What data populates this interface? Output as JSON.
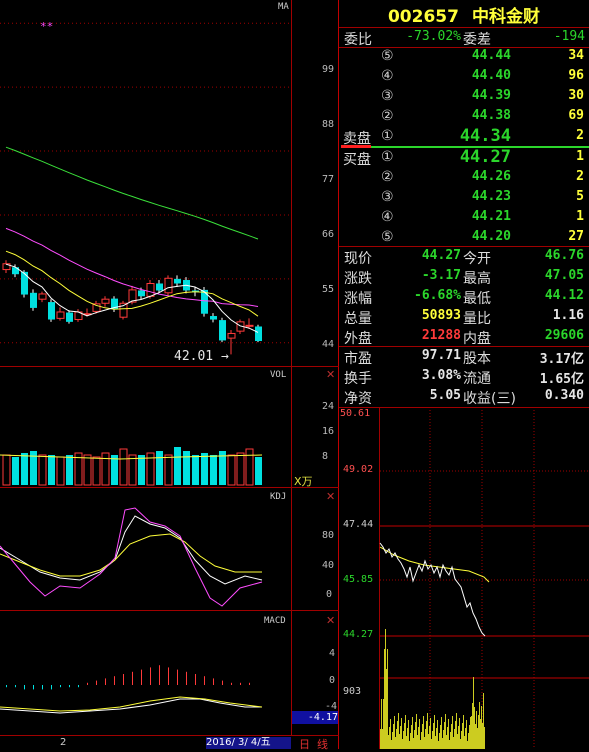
{
  "stock": {
    "code": "002657",
    "name": "中科金财"
  },
  "main_chart": {
    "indicator_label": "MA",
    "marker": "**",
    "y_ticks": [
      "99",
      "88",
      "77",
      "66",
      "55",
      "44"
    ],
    "low_annotation": "42.01 →"
  },
  "vol_panel": {
    "title": "VOL",
    "y_ticks": [
      "24",
      "16",
      "8"
    ],
    "unit": "X万"
  },
  "kdj_panel": {
    "title": "KDJ",
    "y_ticks": [
      "80",
      "40",
      "0"
    ]
  },
  "macd_panel": {
    "title": "MACD",
    "y_ticks": [
      "4",
      "0",
      "-4"
    ],
    "current": "-4.17"
  },
  "bottom": {
    "tick": "2",
    "date": "2016/ 3/ 4/五",
    "tab1": "日",
    "tab2": "线"
  },
  "orderbook": {
    "weibi_label": "委比",
    "weibi": "-73.02%",
    "weicha_label": "委差",
    "weicha": "-194",
    "sell_label": "卖盘",
    "buy_label": "买盘",
    "sells": [
      {
        "lvl": "⑤",
        "price": "44.44",
        "vol": "34"
      },
      {
        "lvl": "④",
        "price": "44.40",
        "vol": "96"
      },
      {
        "lvl": "③",
        "price": "44.39",
        "vol": "30"
      },
      {
        "lvl": "②",
        "price": "44.38",
        "vol": "69"
      },
      {
        "lvl": "①",
        "price": "44.34",
        "vol": "2"
      }
    ],
    "buys": [
      {
        "lvl": "①",
        "price": "44.27",
        "vol": "1"
      },
      {
        "lvl": "②",
        "price": "44.26",
        "vol": "2"
      },
      {
        "lvl": "③",
        "price": "44.23",
        "vol": "5"
      },
      {
        "lvl": "④",
        "price": "44.21",
        "vol": "1"
      },
      {
        "lvl": "⑤",
        "price": "44.20",
        "vol": "27"
      }
    ]
  },
  "quote": [
    {
      "l1": "现价",
      "v1": "44.27",
      "c1": "green",
      "l2": "今开",
      "v2": "46.76",
      "c2": "green"
    },
    {
      "l1": "涨跌",
      "v1": "-3.17",
      "c1": "green",
      "l2": "最高",
      "v2": "47.05",
      "c2": "green"
    },
    {
      "l1": "涨幅",
      "v1": "-6.68%",
      "c1": "green",
      "l2": "最低",
      "v2": "44.12",
      "c2": "green"
    },
    {
      "l1": "总量",
      "v1": "50893",
      "c1": "yellow",
      "l2": "量比",
      "v2": "1.16",
      "c2": "white"
    },
    {
      "l1": "外盘",
      "v1": "21288",
      "c1": "red",
      "l2": "内盘",
      "v2": "29606",
      "c2": "green"
    },
    {
      "l1": "市盈",
      "v1": "97.71",
      "c1": "white",
      "l2": "股本",
      "v2": "3.17亿",
      "c2": "white"
    },
    {
      "l1": "换手",
      "v1": "3.08%",
      "c1": "white",
      "l2": "流通",
      "v2": "1.65亿",
      "c2": "white"
    },
    {
      "l1": "净资",
      "v1": "5.05",
      "c1": "white",
      "l2": "收益(三)",
      "v2": "0.340",
      "c2": "white"
    }
  ],
  "intraday": {
    "price_ticks": [
      "50.61",
      "49.02",
      "47.44",
      "45.85",
      "44.27"
    ],
    "vol_tick": "903"
  },
  "colors": {
    "up": "#ff3a3a",
    "down": "#00e0e0",
    "grid": "#a00000",
    "ma5": "#ffffff",
    "ma10": "#ffff3a",
    "ma20": "#ff4dff",
    "ma60": "#3ae03a"
  },
  "chart_data": {
    "type": "candlestick",
    "ylim": [
      40,
      103
    ],
    "candles": [
      {
        "o": 56.6,
        "c": 57.6,
        "h": 58.2,
        "l": 56.0
      },
      {
        "o": 57.0,
        "c": 55.8,
        "h": 57.5,
        "l": 55.3
      },
      {
        "o": 56.2,
        "c": 52.3,
        "h": 56.5,
        "l": 51.8
      },
      {
        "o": 52.6,
        "c": 50.0,
        "h": 53.2,
        "l": 49.5
      },
      {
        "o": 51.5,
        "c": 52.4,
        "h": 52.8,
        "l": 51.0
      },
      {
        "o": 51.0,
        "c": 48.0,
        "h": 51.5,
        "l": 47.6
      },
      {
        "o": 48.2,
        "c": 49.3,
        "h": 50.1,
        "l": 47.8
      },
      {
        "o": 49.2,
        "c": 47.6,
        "h": 49.6,
        "l": 47.3
      },
      {
        "o": 48.0,
        "c": 49.3,
        "h": 49.8,
        "l": 47.6
      },
      {
        "o": 49.0,
        "c": 49.0,
        "h": 49.9,
        "l": 48.5
      },
      {
        "o": 49.4,
        "c": 50.7,
        "h": 51.2,
        "l": 49.0
      },
      {
        "o": 50.8,
        "c": 51.5,
        "h": 52.0,
        "l": 50.2
      },
      {
        "o": 51.6,
        "c": 49.8,
        "h": 52.0,
        "l": 49.3
      },
      {
        "o": 48.4,
        "c": 50.8,
        "h": 51.2,
        "l": 48.0
      },
      {
        "o": 51.0,
        "c": 53.1,
        "h": 53.8,
        "l": 50.6
      },
      {
        "o": 53.0,
        "c": 52.0,
        "h": 53.5,
        "l": 51.5
      },
      {
        "o": 52.0,
        "c": 54.2,
        "h": 54.8,
        "l": 51.6
      },
      {
        "o": 54.2,
        "c": 53.0,
        "h": 54.8,
        "l": 52.6
      },
      {
        "o": 52.6,
        "c": 55.1,
        "h": 55.6,
        "l": 52.2
      },
      {
        "o": 55.0,
        "c": 54.2,
        "h": 55.6,
        "l": 53.6
      },
      {
        "o": 54.8,
        "c": 53.0,
        "h": 55.3,
        "l": 52.5
      },
      {
        "o": 53.0,
        "c": 52.7,
        "h": 53.6,
        "l": 52.0
      },
      {
        "o": 53.1,
        "c": 49.0,
        "h": 53.6,
        "l": 48.5
      },
      {
        "o": 48.6,
        "c": 48.0,
        "h": 49.1,
        "l": 47.5
      },
      {
        "o": 47.9,
        "c": 44.4,
        "h": 48.3,
        "l": 44.1
      },
      {
        "o": 44.8,
        "c": 45.6,
        "h": 46.2,
        "l": 42.0
      },
      {
        "o": 46.0,
        "c": 47.6,
        "h": 48.0,
        "l": 45.5
      },
      {
        "o": 47.0,
        "c": 47.0,
        "h": 48.2,
        "l": 46.4
      },
      {
        "o": 46.8,
        "c": 44.3,
        "h": 47.1,
        "l": 44.1
      }
    ]
  }
}
